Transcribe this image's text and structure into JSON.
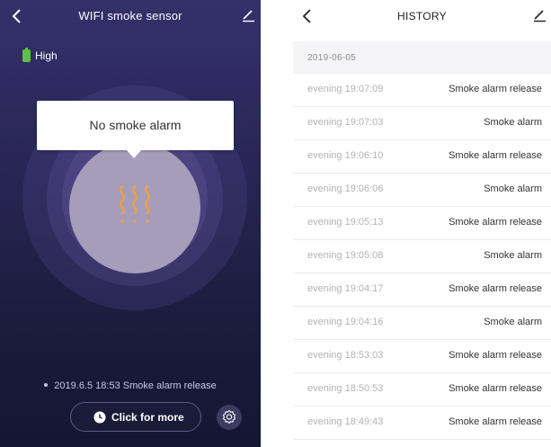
{
  "device_screen": {
    "title": "WIFI smoke sensor",
    "icons": {
      "back": "chevron-left-icon",
      "edit": "pencil-icon",
      "battery": "battery-icon",
      "smoke": "smoke-icon",
      "clock": "clock-icon",
      "settings": "gear-icon"
    },
    "battery": {
      "label": "High",
      "color": "#5bc243"
    },
    "status_bubble": "No smoke alarm",
    "last_event": "2019.6.5 18:53 Smoke alarm release",
    "more_button_label": "Click for more",
    "colors": {
      "accent_orange": "#e9a04a",
      "bg_top": "#34306a",
      "bg_bottom": "#141632"
    }
  },
  "history_screen": {
    "title": "HISTORY",
    "date": "2019-06-05",
    "entries": [
      {
        "time": "evening  19:07:09",
        "event": "Smoke alarm release"
      },
      {
        "time": "evening  19:07:03",
        "event": "Smoke alarm"
      },
      {
        "time": "evening  19:06:10",
        "event": "Smoke alarm release"
      },
      {
        "time": "evening  19:06:06",
        "event": "Smoke alarm"
      },
      {
        "time": "evening  19:05:13",
        "event": "Smoke alarm release"
      },
      {
        "time": "evening  19:05:08",
        "event": "Smoke alarm"
      },
      {
        "time": "evening  19:04:17",
        "event": "Smoke alarm release"
      },
      {
        "time": "evening  19:04:16",
        "event": "Smoke alarm"
      },
      {
        "time": "evening  18:53:03",
        "event": "Smoke alarm release"
      },
      {
        "time": "evening  18:50:53",
        "event": "Smoke alarm release"
      },
      {
        "time": "evening  18:49:43",
        "event": "Smoke alarm release"
      }
    ]
  }
}
